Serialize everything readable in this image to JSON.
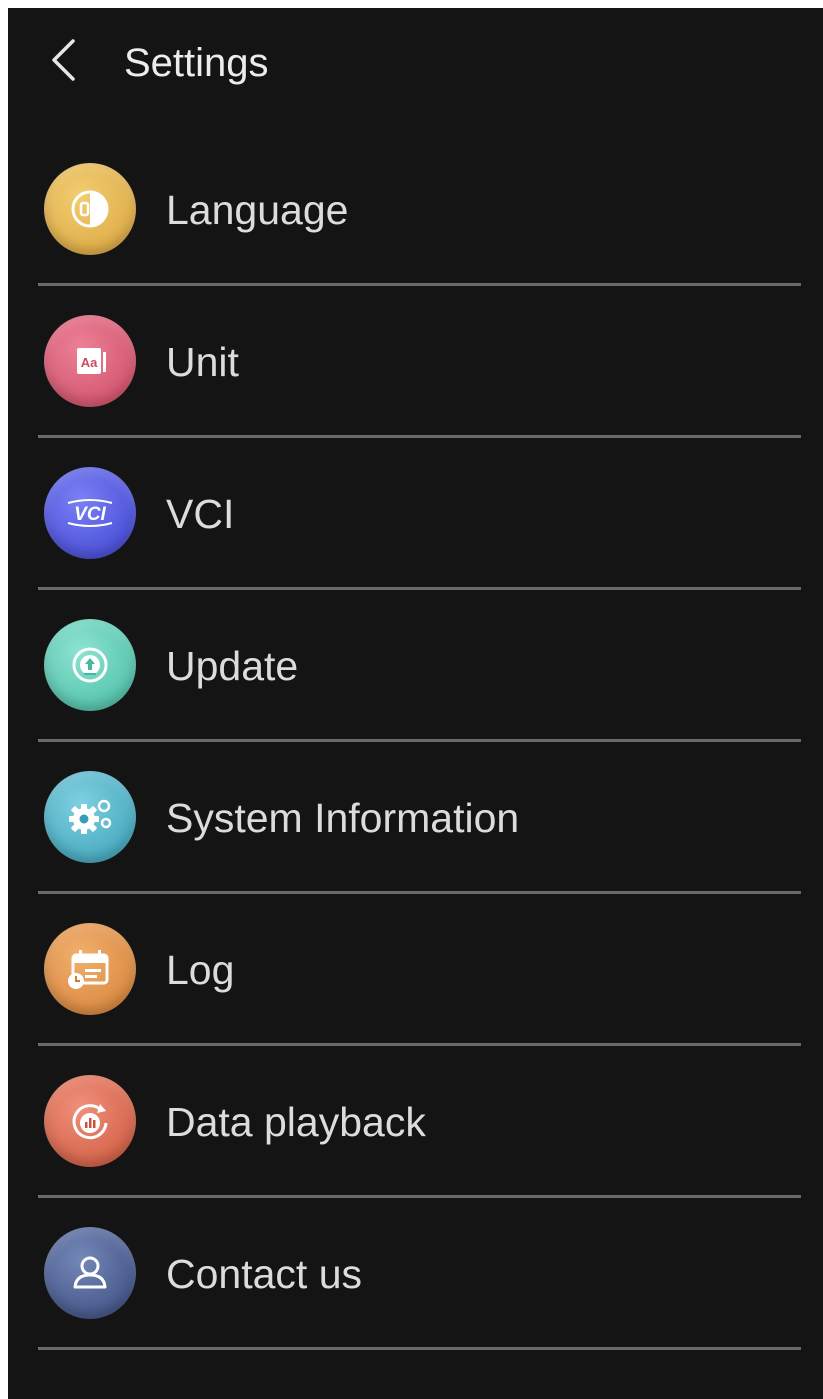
{
  "header": {
    "back_icon": "chevron-left-icon",
    "title": "Settings"
  },
  "menu": [
    {
      "id": "language",
      "label": "Language",
      "icon": "language-icon",
      "color": "#e2b24a"
    },
    {
      "id": "unit",
      "label": "Unit",
      "icon": "unit-icon",
      "color": "#d95c73"
    },
    {
      "id": "vci",
      "label": "VCI",
      "icon": "vci-icon",
      "color": "#4f57e0"
    },
    {
      "id": "update",
      "label": "Update",
      "icon": "update-icon",
      "color": "#5ecdb7"
    },
    {
      "id": "system-information",
      "label": "System Information",
      "icon": "gears-icon",
      "color": "#4fb3c8"
    },
    {
      "id": "log",
      "label": "Log",
      "icon": "log-calendar-icon",
      "color": "#e0904a"
    },
    {
      "id": "data-playback",
      "label": "Data playback",
      "icon": "playback-icon",
      "color": "#de6a52"
    },
    {
      "id": "contact-us",
      "label": "Contact us",
      "icon": "user-icon",
      "color": "#4a5e8a"
    }
  ]
}
